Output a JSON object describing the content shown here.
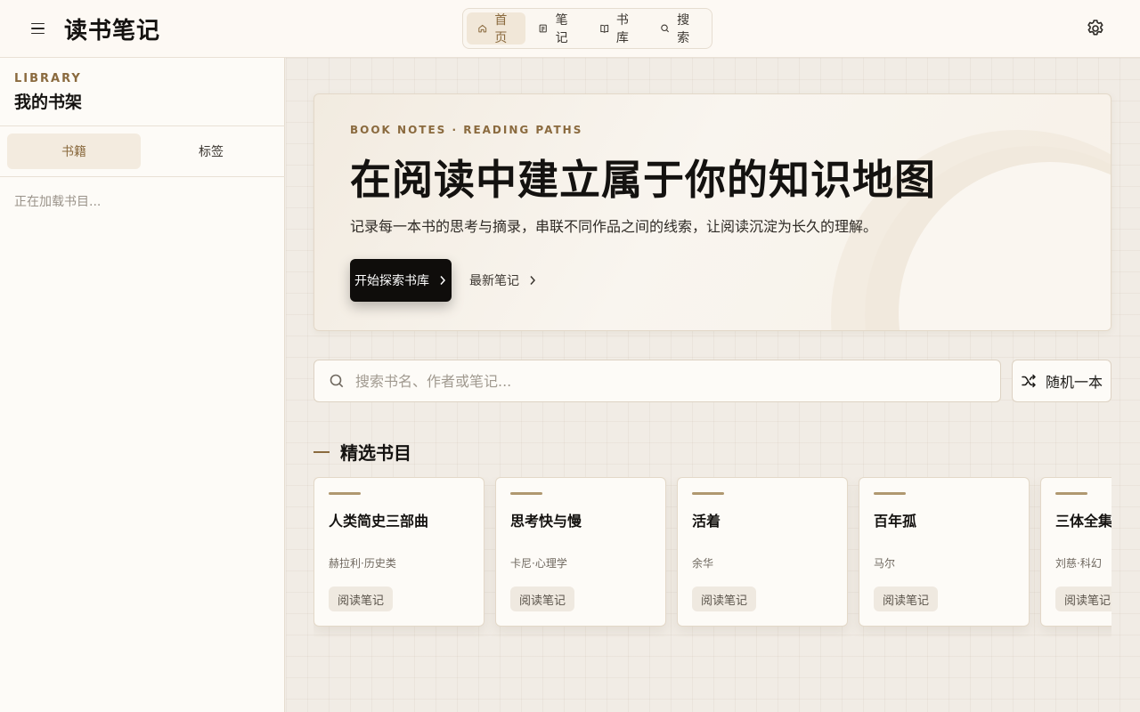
{
  "header": {
    "brand": "读书笔记",
    "nav": [
      {
        "label": "首页",
        "icon": "home-icon",
        "active": true
      },
      {
        "label": "笔记",
        "icon": "note-icon",
        "active": false
      },
      {
        "label": "书库",
        "icon": "book-icon",
        "active": false
      },
      {
        "label": "搜索",
        "icon": "search-icon",
        "active": false
      }
    ]
  },
  "sidebar": {
    "eyebrow": "LIBRARY",
    "title": "我的书架",
    "segments": [
      {
        "label": "书籍",
        "active": true
      },
      {
        "label": "标签",
        "active": false
      }
    ],
    "loading": "正在加载书目..."
  },
  "hero": {
    "eyebrow": "BOOK NOTES · READING PATHS",
    "title": "在阅读中建立属于你的知识地图",
    "subtitle": "记录每一本书的思考与摘录，串联不同作品之间的线索，让阅读沉淀为长久的理解。",
    "primary_cta": "开始探索书库",
    "secondary_cta": "最新笔记"
  },
  "search": {
    "placeholder": "搜索书名、作者或笔记..."
  },
  "shuffle_label": "随机一本",
  "section": {
    "title": "精选书目"
  },
  "books": [
    {
      "title": "人类简史三部曲",
      "author": "赫拉利·历史类",
      "tag": "阅读笔记"
    },
    {
      "title": "思考快与慢",
      "author": "卡尼·心理学",
      "tag": "阅读笔记"
    },
    {
      "title": "活着",
      "author": "余华",
      "tag": "阅读笔记"
    },
    {
      "title": "百年孤",
      "author": "马尔",
      "tag": "阅读笔记"
    },
    {
      "title": "三体全集合",
      "author": "刘慈·科幻",
      "tag": "阅读笔记"
    }
  ],
  "colors": {
    "accent": "#8a6a3e",
    "primary_button": "#0f0d0b",
    "background": "#f1ece5"
  }
}
